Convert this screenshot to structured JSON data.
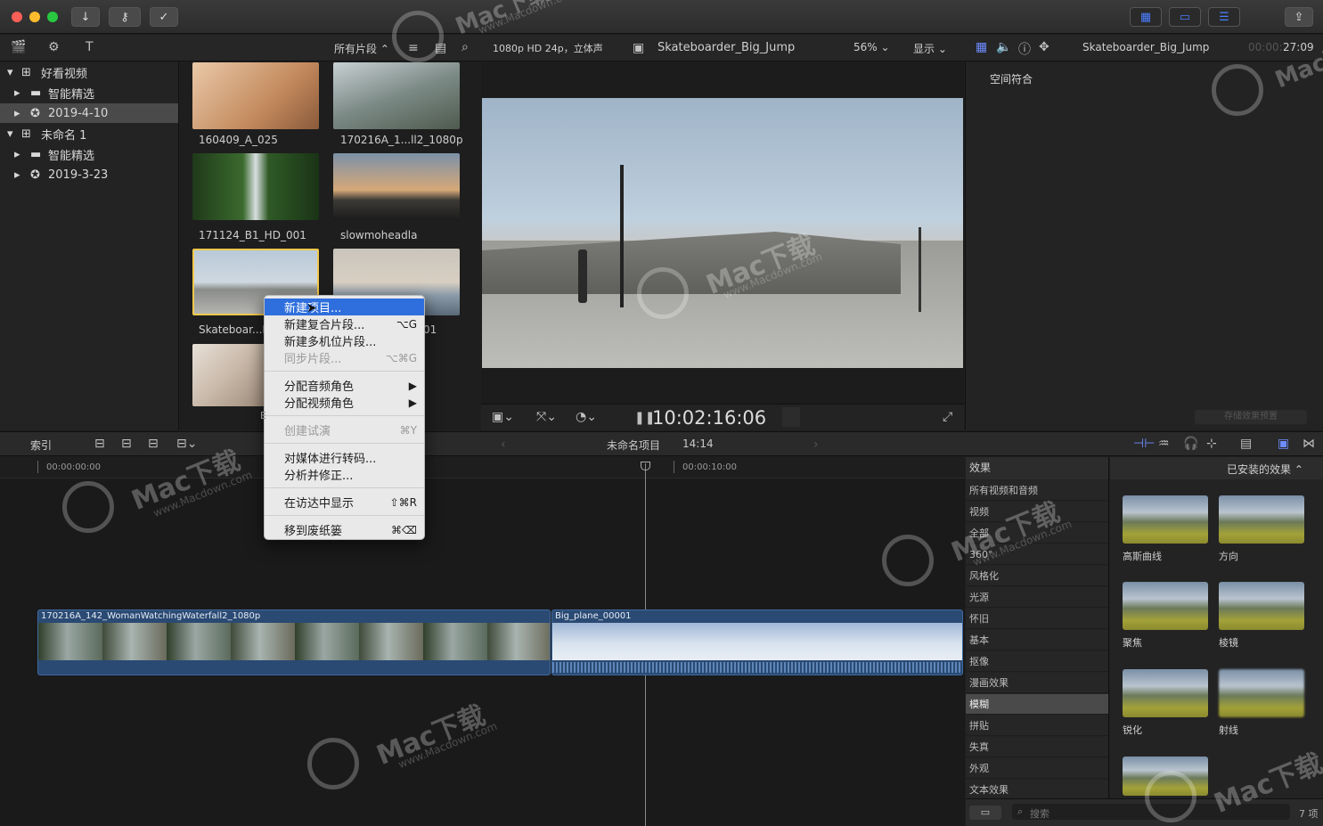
{
  "toolbar": {
    "import_icon": "download-icon",
    "keywords_icon": "key-icon",
    "check_icon": "checkmark-icon"
  },
  "browser_header": {
    "filter_label": "所有片段 ⌃",
    "format": "1080p HD 24p，立体声"
  },
  "viewer": {
    "clip_name": "Skateboarder_Big_Jump",
    "zoom": "56% ⌄",
    "display": "显示 ⌄",
    "timecode": "10:02:16:06"
  },
  "inspector": {
    "clip_name": "Skateboarder_Big_Jump",
    "timecode_dim": "00:00:",
    "timecode": "27:09",
    "section": "空间符合",
    "save_preset": "存储效果预置"
  },
  "library": {
    "items": [
      {
        "label": "好看视频",
        "icon": "library-icon"
      },
      {
        "label": "智能精选",
        "icon": "folder-icon"
      },
      {
        "label": "2019-4-10",
        "icon": "event-icon"
      },
      {
        "label": "未命名 1",
        "icon": "library-icon"
      },
      {
        "label": "智能精选",
        "icon": "folder-icon"
      },
      {
        "label": "2019-3-23",
        "icon": "event-icon"
      }
    ]
  },
  "browser": {
    "clips": [
      {
        "label": "160409_A_025"
      },
      {
        "label": "170216A_1...ll2_1080p"
      },
      {
        "label": "171124_B1_HD_001"
      },
      {
        "label": "slowmoheadla"
      },
      {
        "label": "Skateboar...B"
      },
      {
        "label": "01"
      }
    ]
  },
  "context_menu": {
    "items": [
      {
        "label": "新建项目...",
        "shortcut": ""
      },
      {
        "label": "新建复合片段...",
        "shortcut": "⌥G"
      },
      {
        "label": "新建多机位片段...",
        "shortcut": ""
      },
      {
        "label": "同步片段...",
        "shortcut": "⌥⌘G"
      },
      {
        "label": "分配音频角色",
        "shortcut": "▶"
      },
      {
        "label": "分配视频角色",
        "shortcut": "▶"
      },
      {
        "label": "创建试演",
        "shortcut": "⌘Y"
      },
      {
        "label": "对媒体进行转码...",
        "shortcut": ""
      },
      {
        "label": "分析并修正...",
        "shortcut": ""
      },
      {
        "label": "在访达中显示",
        "shortcut": "⇧⌘R"
      },
      {
        "label": "移到废纸篓",
        "shortcut": "⌘⌫"
      }
    ]
  },
  "timeline": {
    "index_label": "索引",
    "project_name": "未命名项目",
    "duration": "14:14",
    "ruler_start": "00:00:00:00",
    "ruler_mid": "00:00:10:00",
    "clip1": "170216A_142_WomanWatchingWaterfall2_1080p",
    "clip2": "Big_plane_00001",
    "ruler_partial": "E"
  },
  "effects": {
    "header": "效果",
    "installed": "已安装的效果 ⌃",
    "categories": [
      "所有视频和音频",
      "视频",
      "全部",
      "360°",
      "风格化",
      "光源",
      "怀旧",
      "基本",
      "抠像",
      "漫画效果",
      "模糊",
      "拼贴",
      "失真",
      "外观",
      "文本效果"
    ],
    "selected_index": 10,
    "items": [
      "高斯曲线",
      "方向",
      "聚焦",
      "棱镜",
      "锐化",
      "射线",
      ""
    ],
    "search_placeholder": "搜索",
    "count": "7 项"
  },
  "watermark": {
    "brand": "Mac下载",
    "url": "www.Macdown.com"
  }
}
